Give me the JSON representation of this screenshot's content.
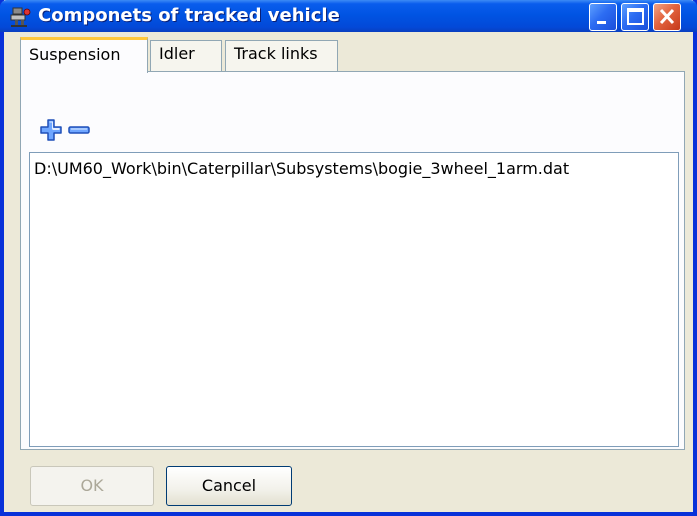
{
  "window": {
    "title": "Componets of tracked vehicle",
    "icon": "app-icon",
    "controls": [
      "minimize-icon",
      "maximize-icon",
      "close-icon"
    ]
  },
  "tabs": [
    {
      "label": "Suspension",
      "active": true
    },
    {
      "label": "Idler",
      "active": false
    },
    {
      "label": "Track links",
      "active": false
    }
  ],
  "toolbar": {
    "add_icon": "plus-icon",
    "remove_icon": "minus-icon"
  },
  "list": {
    "items": [
      "D:\\UM60_Work\\bin\\Caterpillar\\Subsystems\\bogie_3wheel_1arm.dat"
    ]
  },
  "buttons": {
    "ok_label": "OK",
    "ok_enabled": false,
    "cancel_label": "Cancel"
  },
  "colors": {
    "titlebar": "#0054e3",
    "accent_tab": "#ffc83c",
    "icon_blue": "#2f6fd6",
    "close_red": "#e3643f"
  }
}
